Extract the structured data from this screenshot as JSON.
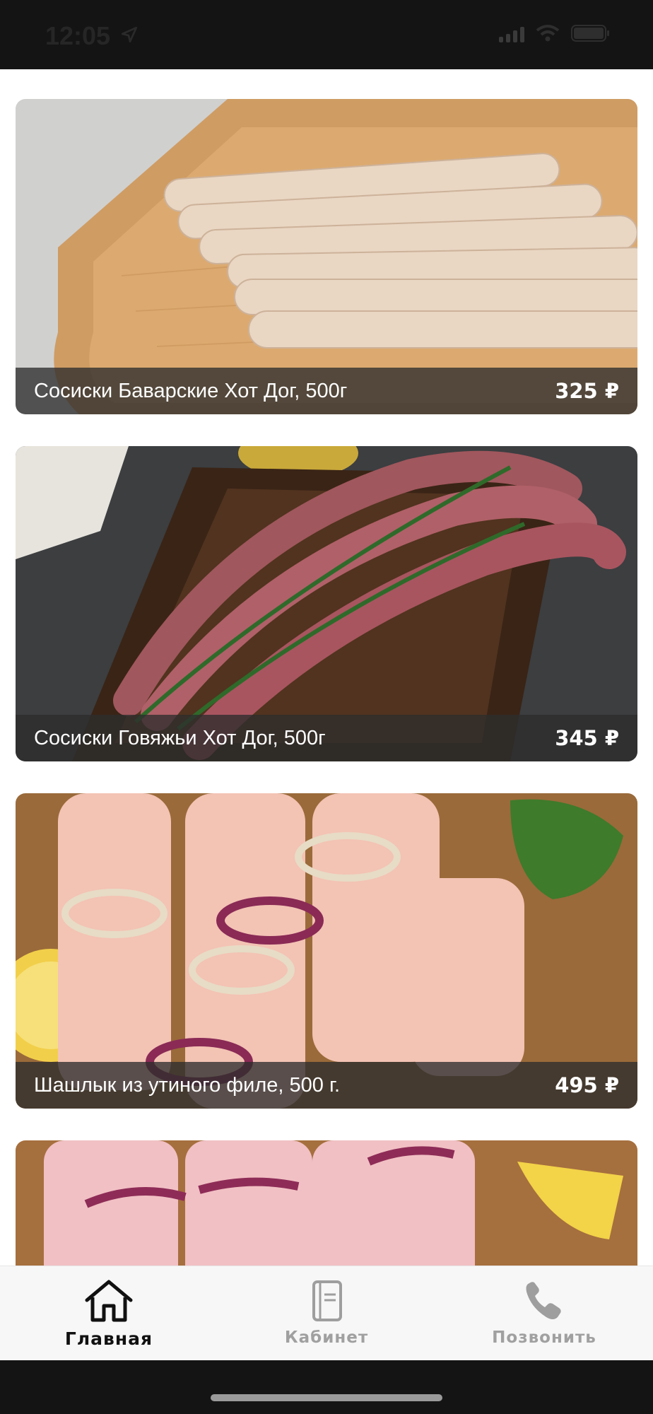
{
  "status_bar": {
    "time": "12:05",
    "icons": [
      "location-arrow-icon",
      "signal-icon",
      "wifi-icon",
      "battery-icon"
    ]
  },
  "products": [
    {
      "title": "Сосиски Баварские Хот Дог, 500г",
      "price": "325 ₽",
      "image": "raw-white-sausages-on-board"
    },
    {
      "title": "Сосиски Говяжьи Хот Дог, 500г",
      "price": "345 ₽",
      "image": "beef-sausages-with-rosemary"
    },
    {
      "title": "Шашлык из утиного филе, 500 г.",
      "price": "495 ₽",
      "image": "duck-fillet-skewers-with-onion"
    },
    {
      "title": "",
      "price": "",
      "image": "pork-kebab-with-onion-and-lemon"
    }
  ],
  "tab_bar": {
    "tabs": [
      {
        "label": "Главная",
        "icon": "home-icon",
        "active": true
      },
      {
        "label": "Кабинет",
        "icon": "notebook-icon",
        "active": false
      },
      {
        "label": "Позвонить",
        "icon": "phone-icon",
        "active": false
      }
    ]
  },
  "colors": {
    "status_bar_bg": "#141414",
    "caption_bg": "#2d2d2d",
    "tab_active": "#111111",
    "tab_inactive": "#a0a0a0"
  }
}
